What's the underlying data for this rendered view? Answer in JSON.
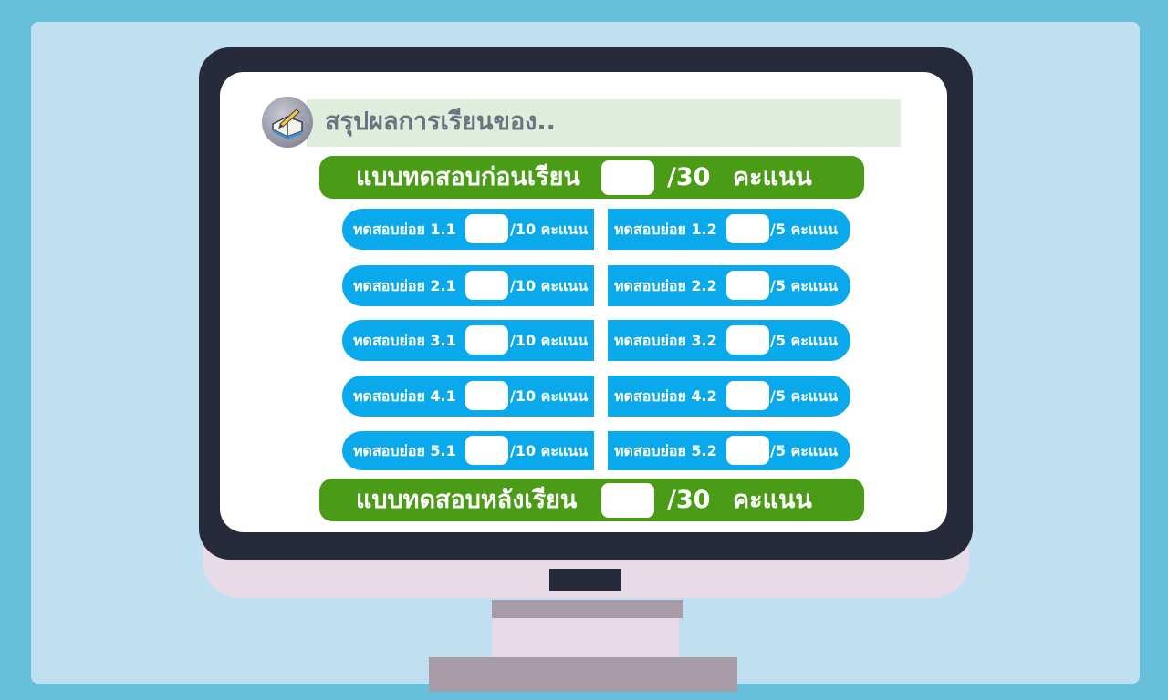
{
  "header": {
    "title": "สรุปผลการเรียนของ..",
    "icon": "book-pen-icon"
  },
  "pretest": {
    "label": "แบบทดสอบก่อนเรียน",
    "score": "",
    "max": "/30",
    "unit": "คะแนน"
  },
  "posttest": {
    "label": "แบบทดสอบหลังเรียน",
    "score": "",
    "max": "/30",
    "unit": "คะแนน"
  },
  "quizzes": [
    {
      "label": "ทดสอบย่อย 1.1",
      "score": "",
      "max": "/10 คะแนน"
    },
    {
      "label": "ทดสอบย่อย 1.2",
      "score": "",
      "max": "/5 คะแนน"
    },
    {
      "label": "ทดสอบย่อย 2.1",
      "score": "",
      "max": "/10 คะแนน"
    },
    {
      "label": "ทดสอบย่อย 2.2",
      "score": "",
      "max": "/5 คะแนน"
    },
    {
      "label": "ทดสอบย่อย 3.1",
      "score": "",
      "max": "/10 คะแนน"
    },
    {
      "label": "ทดสอบย่อย 3.2",
      "score": "",
      "max": "/5 คะแนน"
    },
    {
      "label": "ทดสอบย่อย 4.1",
      "score": "",
      "max": "/10 คะแนน"
    },
    {
      "label": "ทดสอบย่อย 4.2",
      "score": "",
      "max": "/5 คะแนน"
    },
    {
      "label": "ทดสอบย่อย 5.1",
      "score": "",
      "max": "/10 คะแนน"
    },
    {
      "label": "ทดสอบย่อย 5.2",
      "score": "",
      "max": "/5 คะแนน"
    }
  ],
  "colors": {
    "background": "#67bfdc",
    "panel": "#c0dff0",
    "monitor": "#262a3a",
    "test_bar": "#4a9c16",
    "quiz_pill": "#0aa9ec",
    "header_bar": "#deeddc"
  }
}
